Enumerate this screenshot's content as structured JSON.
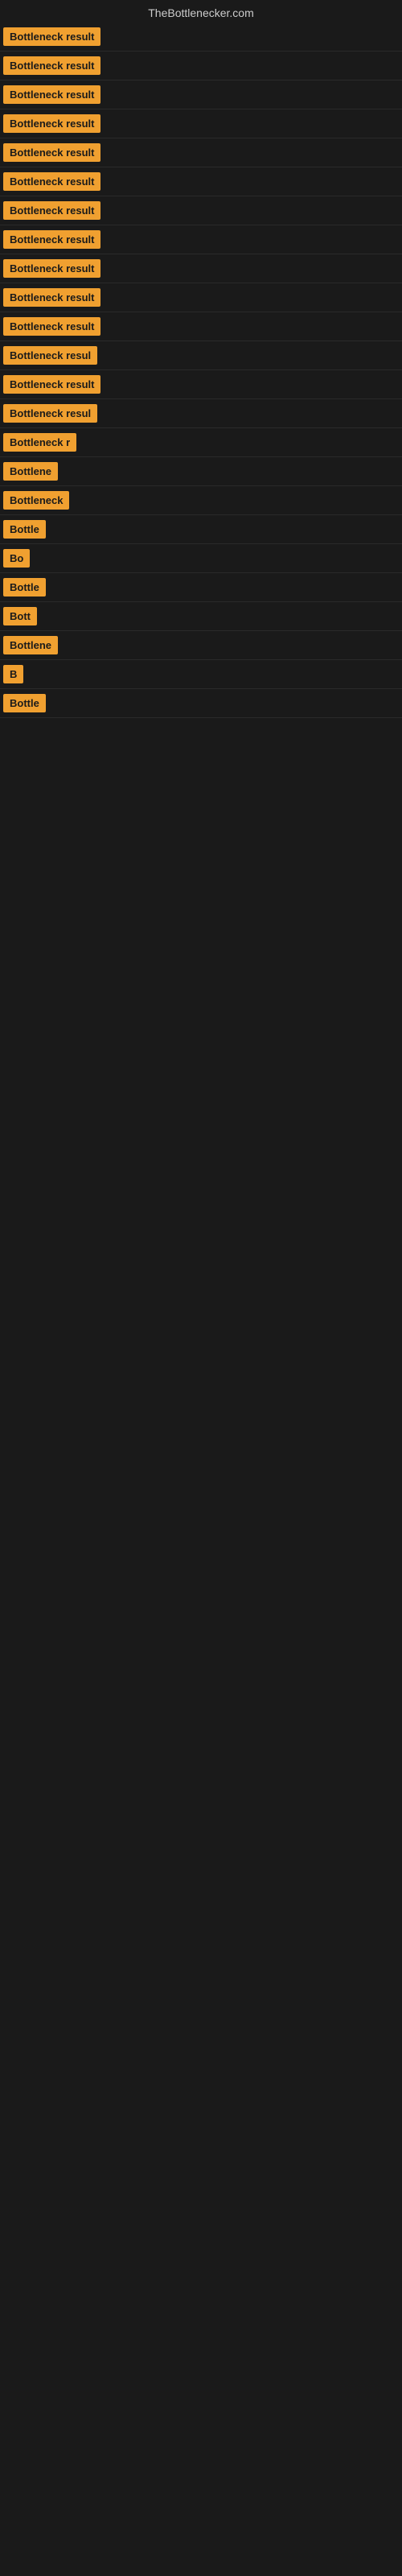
{
  "site": {
    "title": "TheBottlenecker.com"
  },
  "rows": [
    {
      "id": 1,
      "label": "Bottleneck result",
      "visible_text": "Bottleneck result"
    },
    {
      "id": 2,
      "label": "Bottleneck result",
      "visible_text": "Bottleneck result"
    },
    {
      "id": 3,
      "label": "Bottleneck result",
      "visible_text": "Bottleneck result"
    },
    {
      "id": 4,
      "label": "Bottleneck result",
      "visible_text": "Bottleneck result"
    },
    {
      "id": 5,
      "label": "Bottleneck result",
      "visible_text": "Bottleneck result"
    },
    {
      "id": 6,
      "label": "Bottleneck result",
      "visible_text": "Bottleneck result"
    },
    {
      "id": 7,
      "label": "Bottleneck result",
      "visible_text": "Bottleneck result"
    },
    {
      "id": 8,
      "label": "Bottleneck result",
      "visible_text": "Bottleneck result"
    },
    {
      "id": 9,
      "label": "Bottleneck result",
      "visible_text": "Bottleneck result"
    },
    {
      "id": 10,
      "label": "Bottleneck result",
      "visible_text": "Bottleneck result"
    },
    {
      "id": 11,
      "label": "Bottleneck result",
      "visible_text": "Bottleneck result"
    },
    {
      "id": 12,
      "label": "Bottleneck resul",
      "visible_text": "Bottleneck resul"
    },
    {
      "id": 13,
      "label": "Bottleneck result",
      "visible_text": "Bottleneck result"
    },
    {
      "id": 14,
      "label": "Bottleneck resul",
      "visible_text": "Bottleneck resul"
    },
    {
      "id": 15,
      "label": "Bottleneck r",
      "visible_text": "Bottleneck r"
    },
    {
      "id": 16,
      "label": "Bottlene",
      "visible_text": "Bottlene"
    },
    {
      "id": 17,
      "label": "Bottleneck",
      "visible_text": "Bottleneck"
    },
    {
      "id": 18,
      "label": "Bottle",
      "visible_text": "Bottle"
    },
    {
      "id": 19,
      "label": "Bo",
      "visible_text": "Bo"
    },
    {
      "id": 20,
      "label": "Bottle",
      "visible_text": "Bottle"
    },
    {
      "id": 21,
      "label": "Bott",
      "visible_text": "Bott"
    },
    {
      "id": 22,
      "label": "Bottlene",
      "visible_text": "Bottlene"
    },
    {
      "id": 23,
      "label": "B",
      "visible_text": "B"
    },
    {
      "id": 24,
      "label": "Bottle",
      "visible_text": "Bottle"
    }
  ]
}
